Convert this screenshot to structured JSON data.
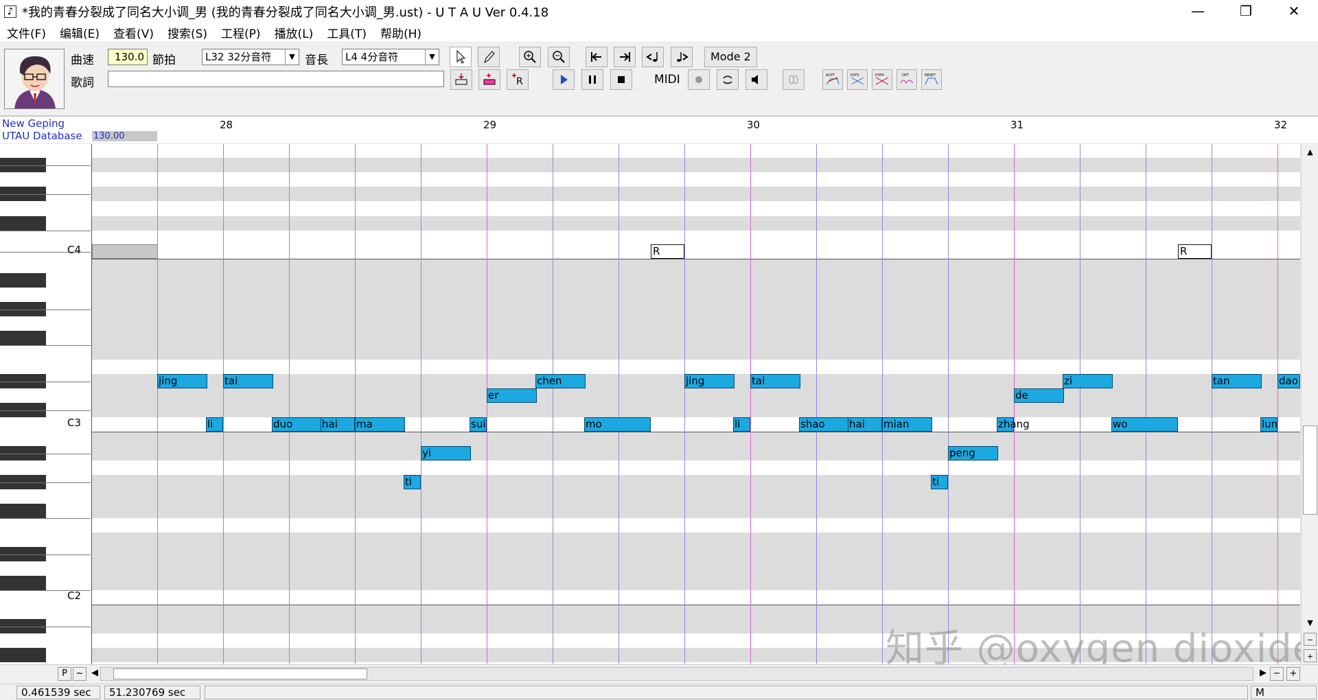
{
  "window": {
    "title": "*我的青春分裂成了同名大小调_男 (我的青春分裂成了同名大小调_男.ust) - U T A U Ver 0.4.18",
    "minimize": "—",
    "restore": "❐",
    "close": "✕"
  },
  "menu": [
    "文件(F)",
    "编辑(E)",
    "查看(V)",
    "搜索(S)",
    "工程(P)",
    "播放(L)",
    "工具(T)",
    "帮助(H)"
  ],
  "toolbar": {
    "tempo_label": "曲速",
    "tempo_value": "130.0",
    "beat_label": "節拍",
    "quantize_value": "L32 32分音符",
    "length_label": "音長",
    "length_value": "L4  4分音符",
    "mode_button": "Mode 2",
    "lyric_label": "歌詞",
    "lyric_value": "",
    "midi_label": "MIDI",
    "playback_bar_labels": [
      "ACPT",
      "P2P3",
      "P3P4",
      "OPT",
      "RESET"
    ]
  },
  "ruler": {
    "voice_name": "New Geping",
    "voice_db": "UTAU Database",
    "tempo": "130.00",
    "bars": [
      "28",
      "29",
      "30",
      "31",
      "32"
    ]
  },
  "keys": {
    "labels": [
      "C4",
      "C3",
      "C2"
    ]
  },
  "notes": [
    {
      "lyric": "jing",
      "pitch": "D#3"
    },
    {
      "lyric": "li",
      "pitch": "C3"
    },
    {
      "lyric": "tai",
      "pitch": "D#3"
    },
    {
      "lyric": "duo",
      "pitch": "C3"
    },
    {
      "lyric": "hai",
      "pitch": "C3"
    },
    {
      "lyric": "ma",
      "pitch": "C3"
    },
    {
      "lyric": "ti",
      "pitch": "G#2"
    },
    {
      "lyric": "yi",
      "pitch": "A#2"
    },
    {
      "lyric": "sui",
      "pitch": "C3"
    },
    {
      "lyric": "er",
      "pitch": "D3"
    },
    {
      "lyric": "chen",
      "pitch": "D#3"
    },
    {
      "lyric": "mo",
      "pitch": "C3"
    },
    {
      "lyric": "R",
      "pitch": "C4"
    },
    {
      "lyric": "jing",
      "pitch": "D#3"
    },
    {
      "lyric": "li",
      "pitch": "C3"
    },
    {
      "lyric": "tai",
      "pitch": "D#3"
    },
    {
      "lyric": "shao",
      "pitch": "C3"
    },
    {
      "lyric": "hai",
      "pitch": "C3"
    },
    {
      "lyric": "mian",
      "pitch": "C3"
    },
    {
      "lyric": "ti",
      "pitch": "G#2"
    },
    {
      "lyric": "peng",
      "pitch": "A#2"
    },
    {
      "lyric": "zhang",
      "pitch": "C3"
    },
    {
      "lyric": "de",
      "pitch": "D3"
    },
    {
      "lyric": "zi",
      "pitch": "D#3"
    },
    {
      "lyric": "wo",
      "pitch": "C3"
    },
    {
      "lyric": "R",
      "pitch": "C4"
    },
    {
      "lyric": "tan",
      "pitch": "D#3"
    },
    {
      "lyric": "lun",
      "pitch": "C3"
    },
    {
      "lyric": "dao",
      "pitch": "D#3"
    }
  ],
  "watermark": "知乎 @oxygen dioxide",
  "scroll": {
    "btn_p": "P",
    "btn_tilde": "~",
    "zoom_minus": "−",
    "zoom_plus": "+"
  },
  "status": {
    "time1": "0.461539 sec",
    "time2": "51.230769 sec",
    "mode": "M"
  }
}
